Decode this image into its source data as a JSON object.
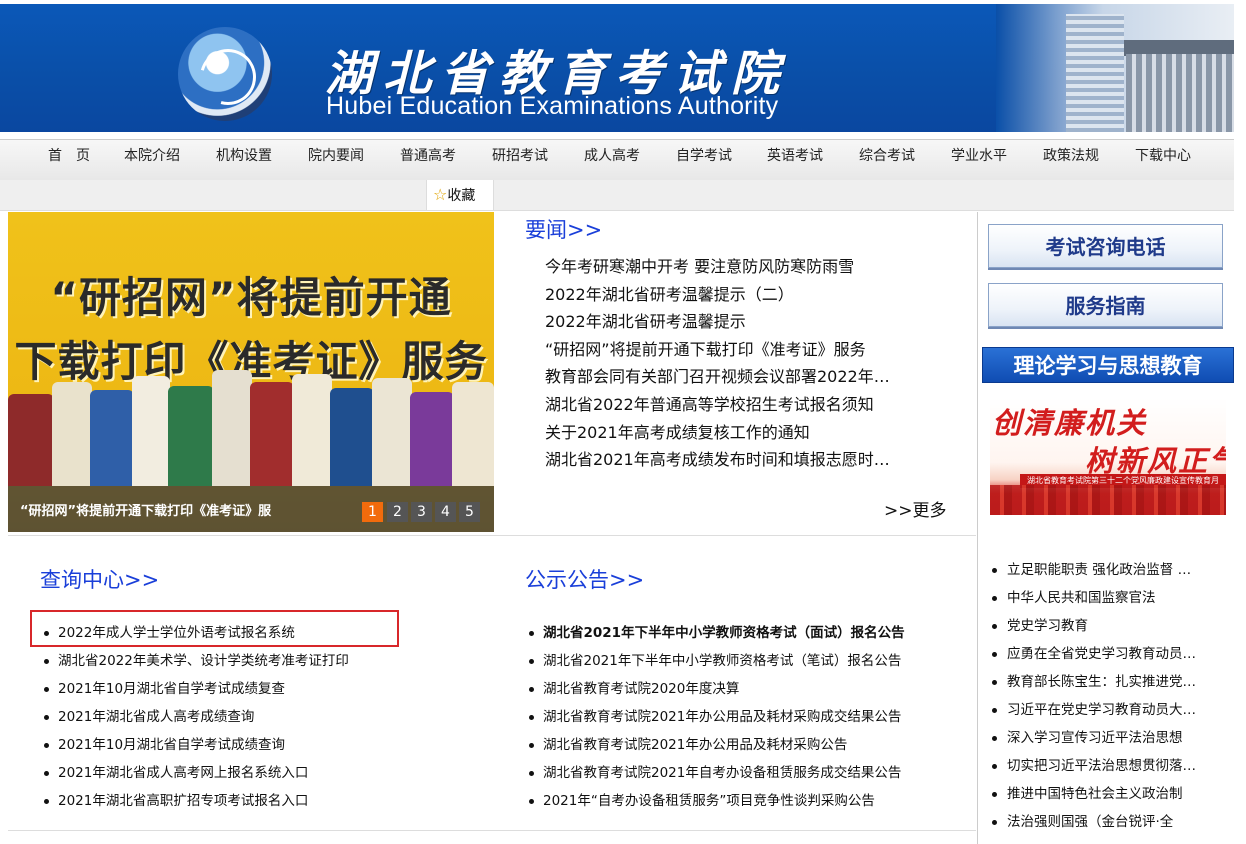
{
  "header": {
    "title_cn": "湖北省教育考试院",
    "title_en": "Hubei Education Examinations Authority",
    "logo_alt": "HBEA 湖北考试",
    "colors": {
      "banner": "#0b58b8"
    }
  },
  "nav": {
    "items": [
      "首　页",
      "本院介绍",
      "机构设置",
      "院内要闻",
      "普通高考",
      "研招考试",
      "成人高考",
      "自学考试",
      "英语考试",
      "综合考试",
      "学业水平",
      "政策法规",
      "下载中心"
    ],
    "favorite": "收藏"
  },
  "slideshow": {
    "headline_1": "“研招网”将提前开通",
    "headline_2": "下载打印《准考证》服务",
    "caption": "“研招网”将提前开通下载打印《准考证》服",
    "pages": [
      "1",
      "2",
      "3",
      "4",
      "5"
    ],
    "active_page": 1,
    "colors": {
      "active": "#f26b0c",
      "background": "#f0c21a"
    }
  },
  "news": {
    "title": "要闻>>",
    "items": [
      "今年考研寒潮中开考 要注意防风防寒防雨雪",
      "2022年湖北省研考温馨提示（二）",
      "2022年湖北省研考温馨提示",
      "“研招网”将提前开通下载打印《准考证》服务",
      "教育部会同有关部门召开视频会议部署2022年…",
      "湖北省2022年普通高等学校招生考试报名须知",
      "关于2021年高考成绩复核工作的通知",
      "湖北省2021年高考成绩发布时间和填报志愿时…"
    ],
    "more": ">>更多"
  },
  "query": {
    "title": "查询中心>>",
    "items": [
      "2022年成人学士学位外语考试报名系统",
      "湖北省2022年美术学、设计学类统考准考证打印",
      "2021年10月湖北省自学考试成绩复查",
      "2021年湖北省成人高考成绩查询",
      "2021年10月湖北省自学考试成绩查询",
      "2021年湖北省成人高考网上报名系统入口",
      "2021年湖北省高职扩招专项考试报名入口"
    ]
  },
  "notices": {
    "title": "公示公告>>",
    "items": [
      "湖北省2021年下半年中小学教师资格考试（面试）报名公告",
      "湖北省2021年下半年中小学教师资格考试（笔试）报名公告",
      "湖北省教育考试院2020年度决算",
      "湖北省教育考试院2021年办公用品及耗材采购成交结果公告",
      "湖北省教育考试院2021年办公用品及耗材采购公告",
      "湖北省教育考试院2021年自考办设备租赁服务成交结果公告",
      "2021年“自考办设备租赁服务”项目竞争性谈判采购公告"
    ]
  },
  "sidebar": {
    "btn_phone": "考试咨询电话",
    "btn_guide": "服务指南",
    "bar": "理论学习与思想教育",
    "banner_line1": "创清廉机关",
    "banner_line2": "树新风正气",
    "banner_band": "湖北省教育考试院第三十二个党风廉政建设宣传教育月",
    "items": [
      "立足职能职责 强化政治监督 …",
      "中华人民共和国监察官法",
      "党史学习教育",
      "应勇在全省党史学习教育动员…",
      "教育部长陈宝生：扎实推进党…",
      "习近平在党史学习教育动员大…",
      "深入学习宣传习近平法治思想",
      "切实把习近平法治思想贯彻落…",
      "推进中国特色社会主义政治制",
      "法治强则国强（金台锐评·全"
    ]
  }
}
